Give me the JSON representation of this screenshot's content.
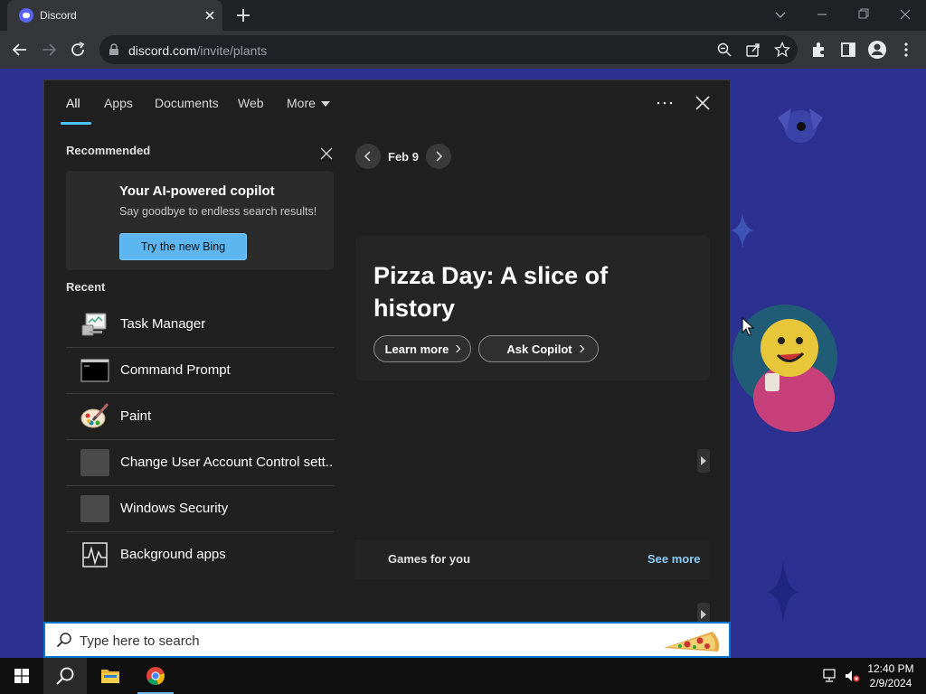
{
  "browser": {
    "tab_title": "Discord",
    "url_host": "discord.com",
    "url_path": "/invite/plants"
  },
  "panel": {
    "nav_tabs": [
      "All",
      "Apps",
      "Documents",
      "Web",
      "More"
    ],
    "recommended_title": "Recommended",
    "copilot_title": "Your AI-powered copilot",
    "copilot_subtitle": "Say goodbye to endless search results!",
    "copilot_button": "Try the new Bing",
    "recent_title": "Recent",
    "recent_items": [
      {
        "label": "Task Manager",
        "icon": "task-manager-icon"
      },
      {
        "label": "Command Prompt",
        "icon": "command-prompt-icon"
      },
      {
        "label": "Paint",
        "icon": "paint-icon"
      },
      {
        "label": "Change User Account Control sett...",
        "icon": "uac-settings-icon"
      },
      {
        "label": "Windows Security",
        "icon": "windows-security-icon"
      },
      {
        "label": "Background apps",
        "icon": "background-apps-icon"
      }
    ],
    "date_label": "Feb 9",
    "hero_title": "Pizza Day: A slice of history",
    "learn_more": "Learn more",
    "ask_copilot": "Ask Copilot",
    "games_title": "Games for you",
    "see_more": "See more"
  },
  "search": {
    "placeholder": "Type here to search"
  },
  "taskbar": {
    "time": "12:40 PM",
    "date": "2/9/2024"
  },
  "colors": {
    "accent": "#4cc2ff",
    "bing_button": "#5db6f0",
    "discord_bg": "#2c3090"
  }
}
